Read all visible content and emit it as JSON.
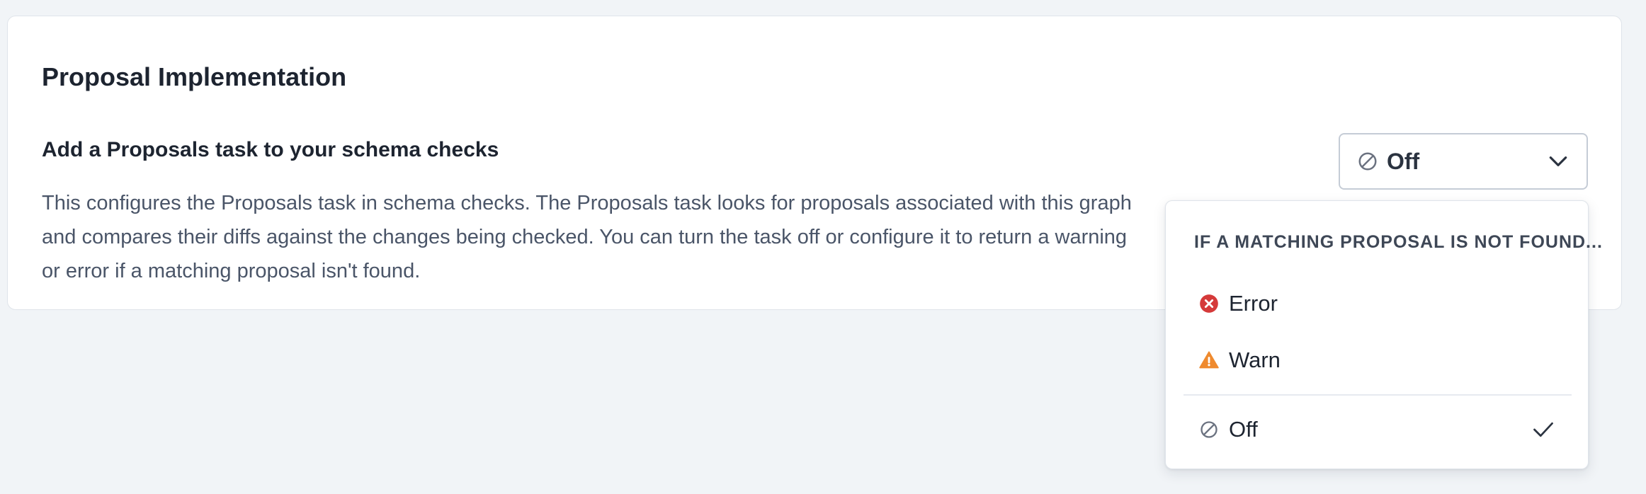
{
  "card": {
    "title": "Proposal Implementation",
    "setting": {
      "heading": "Add a Proposals task to your schema checks",
      "description": "This configures the Proposals task in schema checks. The Proposals task looks for proposals associated with this graph and compares their diffs against the changes being checked. You can turn the task off or configure it to return a warning or error if a matching proposal isn't found."
    }
  },
  "select": {
    "value": "Off",
    "icon": "off-icon"
  },
  "menu": {
    "header": "IF A MATCHING PROPOSAL IS NOT FOUND...",
    "items": [
      {
        "label": "Error",
        "icon": "error-icon",
        "color": "#d53a3a",
        "selected": false
      },
      {
        "label": "Warn",
        "icon": "warning-icon",
        "color": "#ef8a2e",
        "selected": false
      },
      {
        "label": "Off",
        "icon": "off-icon",
        "color": "#6b7280",
        "selected": true
      }
    ]
  }
}
